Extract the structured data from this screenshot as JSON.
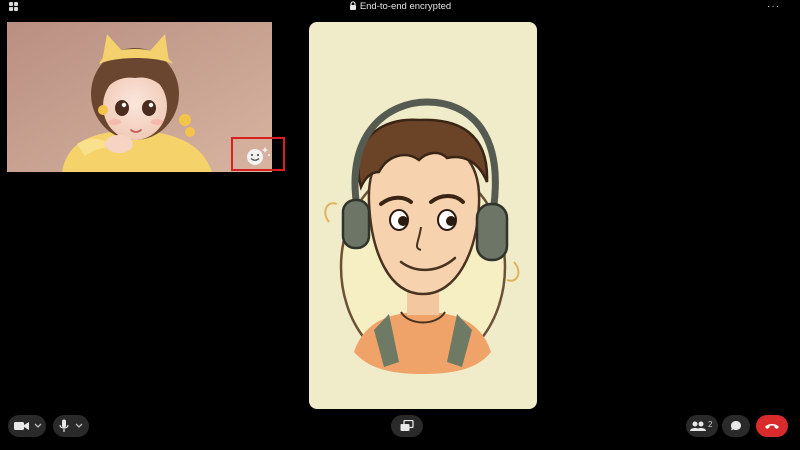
{
  "header": {
    "title": "End-to-end encrypted"
  },
  "icons": {
    "window": "grid-icon",
    "encryption": "lock-icon",
    "menu": "more-options-icon",
    "effects": "smiley-sparkle-icon",
    "camera": "video-camera-icon",
    "microphone": "microphone-icon",
    "layout": "switch-layout-icon",
    "participants": "people-icon",
    "chat": "chat-bubble-icon",
    "end_call": "hang-up-icon"
  },
  "controls": {
    "participants_count": "2"
  },
  "colors": {
    "background": "#000000",
    "control_bg": "#2a2a2a",
    "end_call": "#d92b2b",
    "highlight": "#d8201e",
    "remote_tile_bg": "#f0ecc9"
  }
}
